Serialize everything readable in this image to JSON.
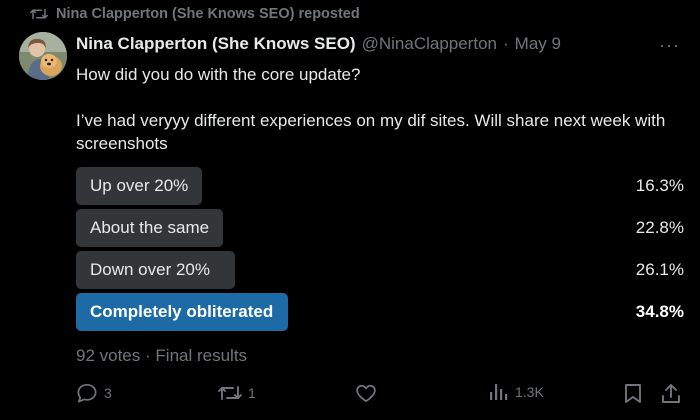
{
  "repost": {
    "icon": "repost-icon",
    "text": "Nina Clapperton (She Knows SEO) reposted"
  },
  "author": {
    "name": "Nina Clapperton (She Knows SEO)",
    "handle": "@NinaClapperton",
    "separator": "·",
    "date": "May 9",
    "avatar_icon": "avatar"
  },
  "more_icon": "more-icon",
  "more_label": "···",
  "tweet": {
    "line1": "How did you do with the core update?",
    "line2": "I’ve had veryyy different experiences on my dif sites.  Will share next week with screenshots"
  },
  "poll": {
    "options": [
      {
        "label": "Up over 20%",
        "percent": "16.3%",
        "value": 16.3
      },
      {
        "label": "About the same",
        "percent": "22.8%",
        "value": 22.8
      },
      {
        "label": "Down over 20%",
        "percent": "26.1%",
        "value": 26.1
      },
      {
        "label": "Completely obliterated",
        "percent": "34.8%",
        "value": 34.8,
        "winner": true
      }
    ],
    "votes": "92 votes",
    "separator": "·",
    "status": "Final results"
  },
  "actions": {
    "reply_count": "3",
    "repost_count": "1",
    "like_count": "",
    "views_count": "1.3K"
  },
  "colors": {
    "background": "#000000",
    "text": "#e7e9ea",
    "muted": "#71767b",
    "bar": "#333639",
    "winner_bar": "#1d6ba6"
  }
}
